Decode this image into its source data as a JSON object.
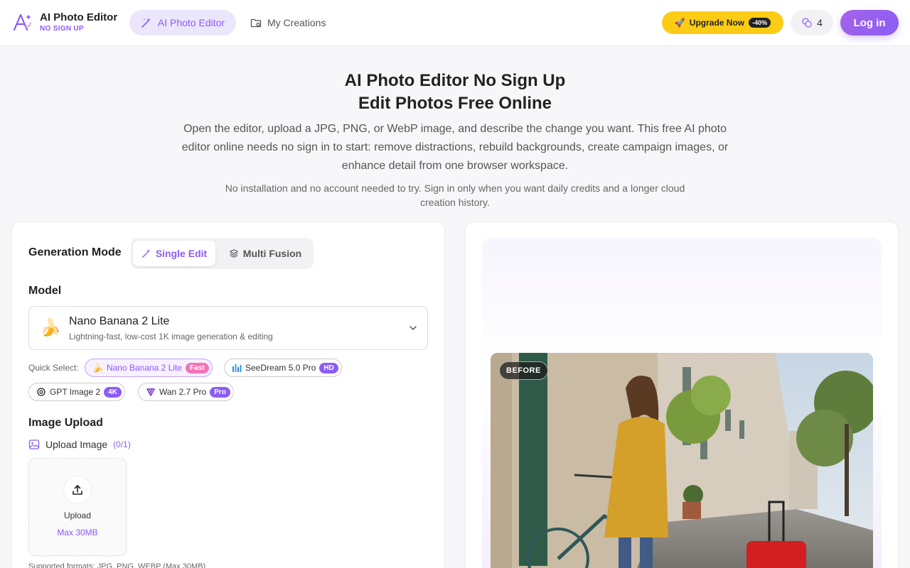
{
  "header": {
    "brand_title": "AI Photo Editor",
    "brand_subtitle": "NO SIGN UP",
    "nav_active": "AI Photo Editor",
    "nav_creations": "My Creations",
    "upgrade_label": "Upgrade Now",
    "upgrade_discount": "-40%",
    "credits_count": "4",
    "login_label": "Log in"
  },
  "hero": {
    "title_line1": "AI Photo Editor No Sign Up",
    "title_line2": "Edit Photos Free Online",
    "description": "Open the editor, upload a JPG, PNG, or WebP image, and describe the change you want. This free AI photo editor online needs no sign in to start: remove distractions, rebuild backgrounds, create campaign images, or enhance detail from one browser workspace.",
    "note": "No installation and no account needed to try. Sign in only when you want daily credits and a longer cloud creation history."
  },
  "editor": {
    "generation_mode_label": "Generation Mode",
    "mode_single": "Single Edit",
    "mode_multi": "Multi Fusion",
    "model_label": "Model",
    "model_selected_name": "Nano Banana 2 Lite",
    "model_selected_desc": "Lightning-fast, low-cost 1K image generation & editing",
    "model_selected_emoji": "🍌",
    "quick_select_label": "Quick Select:",
    "quick_models": [
      {
        "name": "Nano Banana 2 Lite",
        "badge": "Fast",
        "icon": "banana-icon"
      },
      {
        "name": "SeeDream 5.0 Pro",
        "badge": "HD",
        "icon": "seedream-icon"
      },
      {
        "name": "GPT Image 2",
        "badge": "4K",
        "icon": "openai-icon"
      },
      {
        "name": "Wan 2.7 Pro",
        "badge": "Pro",
        "icon": "wan-icon"
      }
    ],
    "image_upload_label": "Image Upload",
    "upload_image_label": "Upload Image",
    "upload_count": "(0/1)",
    "upload_button": "Upload",
    "upload_max": "Max 30MB",
    "supported_formats": "Supported formats: JPG, PNG, WEBP (Max 30MB)"
  },
  "preview": {
    "before_label": "BEFORE"
  },
  "colors": {
    "accent": "#8b5cf6",
    "upgrade": "#facc15",
    "fast_badge": "#f472b6"
  }
}
